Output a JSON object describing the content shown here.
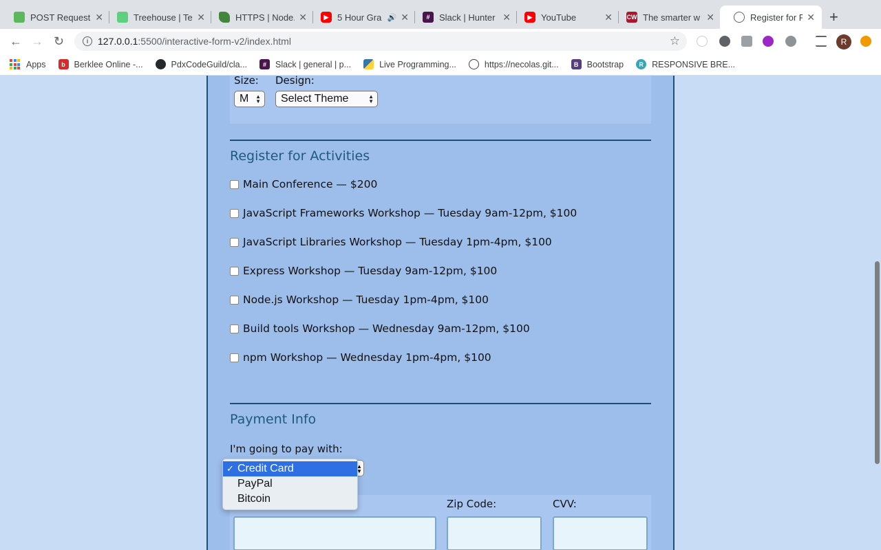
{
  "browser": {
    "tabs": [
      {
        "title": "POST Request",
        "favicon_color": "#5cb85c"
      },
      {
        "title": "Treehouse | Te",
        "favicon_color": "#5fcf80"
      },
      {
        "title": "HTTPS | Node.",
        "favicon_color": "#43853d"
      },
      {
        "title": "5 Hour Gra",
        "favicon_color": "#ff0000"
      },
      {
        "title": "Slack | Hunter",
        "favicon_color": "#4a154b"
      },
      {
        "title": "YouTube",
        "favicon_color": "#ff0000"
      },
      {
        "title": "The smarter w",
        "favicon_color": "#a6192e"
      },
      {
        "title": "Register for Fu",
        "favicon_color": "#5f6368"
      }
    ],
    "url_host": "127.0.0.1",
    "url_path": ":5500/interactive-form-v2/index.html",
    "avatar_letter": "R",
    "bookmarks": [
      "Apps",
      "Berklee Online -...",
      "PdxCodeGuild/cla...",
      "Slack | general | p...",
      "Live Programming...",
      "https://necolas.git...",
      "Bootstrap",
      "RESPONSIVE BRE..."
    ]
  },
  "shirt": {
    "size_label": "Size:",
    "size_value": "M",
    "design_label": "Design:",
    "design_value": "Select Theme"
  },
  "activities": {
    "title": "Register for Activities",
    "items": [
      "Main Conference — $200",
      "JavaScript Frameworks Workshop — Tuesday 9am-12pm, $100",
      "JavaScript Libraries Workshop — Tuesday 1pm-4pm, $100",
      "Express Workshop — Tuesday 9am-12pm, $100",
      "Node.js Workshop — Tuesday 1pm-4pm, $100",
      "Build tools Workshop — Wednesday 9am-12pm, $100",
      "npm Workshop — Wednesday 1pm-4pm, $100"
    ]
  },
  "payment": {
    "title": "Payment Info",
    "pay_label": "I'm going to pay with:",
    "options": [
      "Credit Card",
      "PayPal",
      "Bitcoin"
    ],
    "selected": "Credit Card",
    "check_glyph": "✓",
    "zip_label": "Zip Code:",
    "cvv_label": "CVV:"
  },
  "colors": {
    "page_bg": "#c8dcf6",
    "form_bg": "#9dbdeb",
    "heading": "#1e5a7c",
    "selected_option": "#2f6fe4"
  }
}
